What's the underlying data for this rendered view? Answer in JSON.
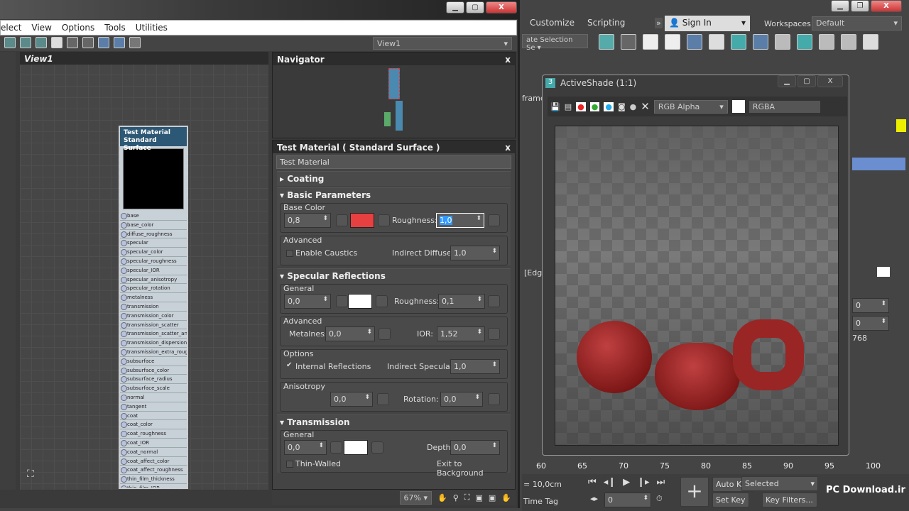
{
  "slate": {
    "menu": [
      "elect",
      "View",
      "Options",
      "Tools",
      "Utilities"
    ],
    "view_dropdown": "View1",
    "view_tab": "View1",
    "navigator_title": "Navigator",
    "node": {
      "title1": "Test Material",
      "title2": "Standard Surface",
      "slots": [
        "base",
        "base_color",
        "diffuse_roughness",
        "specular",
        "specular_color",
        "specular_roughness",
        "specular_IOR",
        "specular_anisotropy",
        "specular_rotation",
        "metalness",
        "transmission",
        "transmission_color",
        "transmission_scatter",
        "transmission_scatter_ani...",
        "transmission_dispersion",
        "transmission_extra_roug...",
        "subsurface",
        "subsurface_color",
        "subsurface_radius",
        "subsurface_scale",
        "normal",
        "tangent",
        "coat",
        "coat_color",
        "coat_roughness",
        "coat_IOR",
        "coat_normal",
        "coat_affect_color",
        "coat_affect_roughness",
        "thin_film_thickness",
        "thin_film_IOR"
      ]
    },
    "material": {
      "title": "Test Material  ( Standard Surface )",
      "name": "Test Material",
      "coating": "Coating",
      "basic": {
        "label": "Basic Parameters",
        "base_color_group": "Base Color",
        "base_value": "0,8",
        "base_color": "#e84040",
        "roughness_label": "Roughness:",
        "roughness": "1,0",
        "advanced": "Advanced",
        "caustics": "Enable Caustics",
        "indirect_diffuse_label": "Indirect Diffuse:",
        "indirect_diffuse": "1,0"
      },
      "specular": {
        "label": "Specular Reflections",
        "general": "General",
        "value": "0,0",
        "color": "#ffffff",
        "roughness_label": "Roughness:",
        "roughness": "0,1",
        "advanced": "Advanced",
        "metalness_label": "Metalness:",
        "metalness": "0,0",
        "ior_label": "IOR:",
        "ior": "1,52",
        "options": "Options",
        "internal_reflections": "Internal Reflections",
        "indirect_specular_label": "Indirect Specular:",
        "indirect_specular": "1,0",
        "anisotropy": "Anisotropy",
        "anisotropy_value": "0,0",
        "rotation_label": "Rotation:",
        "rotation": "0,0"
      },
      "transmission": {
        "label": "Transmission",
        "general": "General",
        "value": "0,0",
        "color": "#ffffff",
        "depth_label": "Depth:",
        "depth": "0,0",
        "thin_walled": "Thin-Walled",
        "exit_bg": "Exit to Background"
      }
    },
    "zoom": "67%"
  },
  "main": {
    "menu": [
      "Customize",
      "Scripting"
    ],
    "sign_in": "Sign In",
    "workspaces_label": "Workspaces:",
    "workspace": "Default",
    "selection_set": "ate Selection Se",
    "side_labels": [
      "frame",
      "[Edg"
    ],
    "right_values": [
      "0",
      "0",
      "768"
    ]
  },
  "activeshade": {
    "title": "ActiveShade (1:1)",
    "channel": "RGB Alpha",
    "display": "RGBA"
  },
  "timeline": {
    "ticks": [
      "60",
      "65",
      "70",
      "75",
      "80",
      "85",
      "90",
      "95",
      "100"
    ]
  },
  "bottom": {
    "grid": "= 10,0cm",
    "time_tag": "Time Tag",
    "frame": "0",
    "auto_key": "Auto Key",
    "set_key": "Set Key",
    "selected": "Selected",
    "key_filters": "Key Filters...",
    "watermark": "PC Download.ir"
  }
}
